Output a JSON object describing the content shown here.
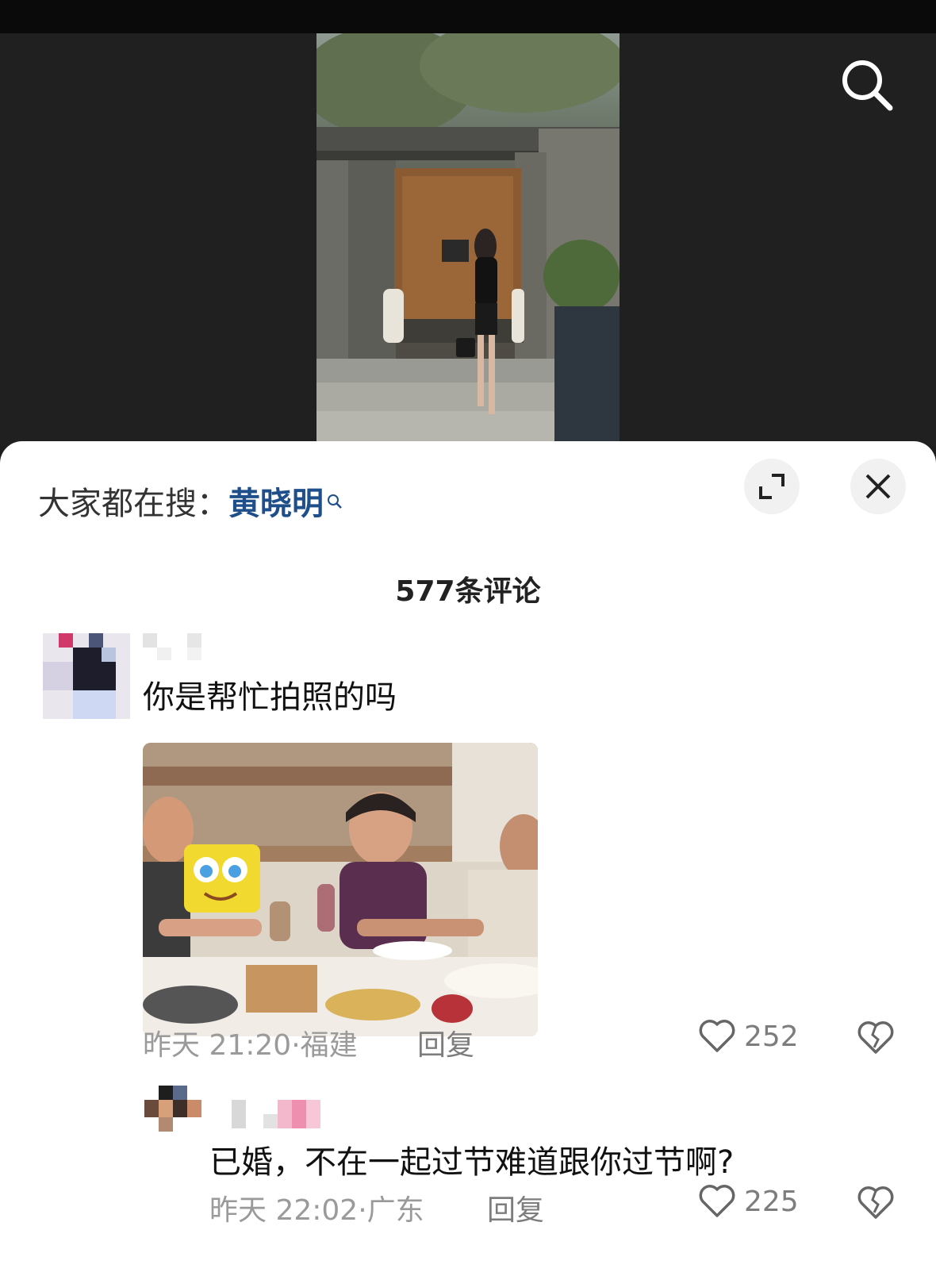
{
  "video": {
    "search_icon": "search-icon"
  },
  "panel": {
    "hot_search_prefix": "大家都在搜：",
    "hot_search_keyword": "黄晓明",
    "comment_count": "577条评论",
    "expand_icon": "expand-icon",
    "close_icon": "close-icon"
  },
  "comments": [
    {
      "text": "你是帮忙拍照的吗",
      "time": "昨天 21:20",
      "sep": "·",
      "location": "福建",
      "reply_label": "回复",
      "likes": "252",
      "has_image": true
    },
    {
      "text": "已婚，不在一起过节难道跟你过节啊?",
      "time": "昨天 22:02",
      "sep": "·",
      "location": "广东",
      "reply_label": "回复",
      "likes": "225"
    }
  ],
  "colors": {
    "keyword": "#1f4f8a",
    "meta": "#9a9a9a",
    "sheet": "#ffffff",
    "video_bg": "#202020"
  }
}
